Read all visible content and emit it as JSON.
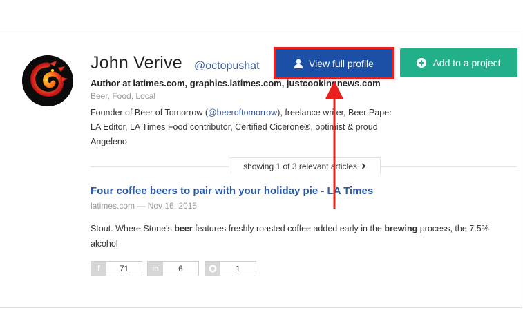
{
  "profile": {
    "name": "John Verive",
    "handle": "@octopushat",
    "author_line": "Author at latimes.com, graphics.latimes.com, justcookingnews.com",
    "tags": "Beer, Food, Local",
    "bio_before": "Founder of Beer of Tomorrow (",
    "bio_link": "@beeroftomorrow",
    "bio_after": "), freelance writer, Beer Paper LA Editor, LA Times Food contributor, Certified Cicerone®, optimist & proud Angeleno"
  },
  "actions": {
    "view_profile_label": "View full profile",
    "add_project_label": "Add to a project"
  },
  "pager": {
    "label": "showing 1 of 3 relevant articles"
  },
  "article": {
    "title": "Four coffee beers to pair with your holiday pie - LA Times",
    "source": "latimes.com",
    "date": "Nov 16, 2015",
    "snippet": [
      {
        "text": "Stout. Where Stone's ",
        "bold": false
      },
      {
        "text": "beer",
        "bold": true
      },
      {
        "text": " features freshly roasted coffee added early in the ",
        "bold": false
      },
      {
        "text": "brewing",
        "bold": true
      },
      {
        "text": " process, the 7.5% alcohol",
        "bold": false
      }
    ]
  },
  "shares": [
    {
      "network": "facebook",
      "icon": "facebook-icon",
      "count": "71"
    },
    {
      "network": "linkedin",
      "icon": "linkedin-icon",
      "count": "6"
    },
    {
      "network": "pinterest",
      "icon": "pinterest-icon",
      "count": "1"
    }
  ],
  "colors": {
    "primary_button": "#1c4fa6",
    "secondary_button": "#22b08b",
    "highlight": "#e8201e",
    "link": "#3b5998"
  }
}
